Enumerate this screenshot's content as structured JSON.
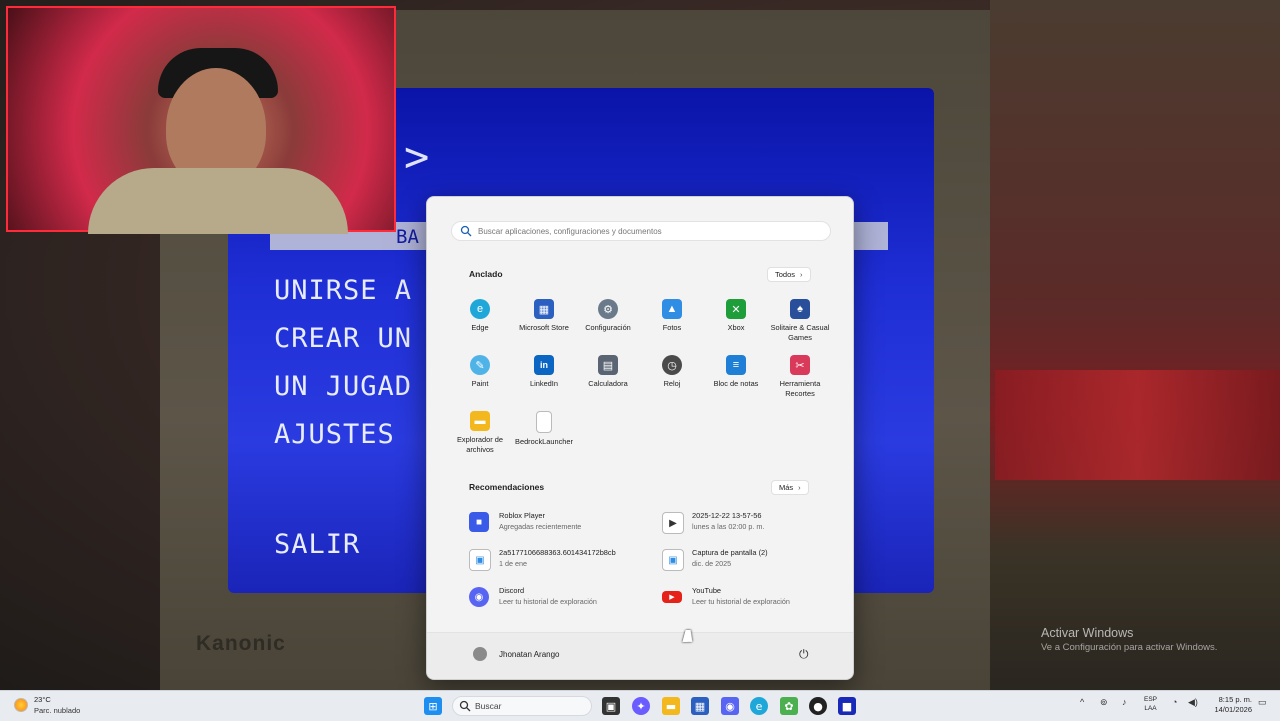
{
  "game": {
    "arrow": ">",
    "selected_label": "BA",
    "menu": [
      "UNIRSE A",
      "CREAR UN",
      "UN JUGAD",
      "AJUSTES",
      "SALIR"
    ],
    "brand": "Kanonic"
  },
  "start_menu": {
    "search_placeholder": "Buscar aplicaciones, configuraciones y documentos",
    "pinned_title": "Anclado",
    "all_button": "Todos",
    "pinned": [
      {
        "label": "Edge",
        "icon": "edge-icon",
        "color": "#1fa7d9"
      },
      {
        "label": "Microsoft Store",
        "icon": "store-icon",
        "color": "#2b5fc0"
      },
      {
        "label": "Configuración",
        "icon": "gear-icon",
        "color": "#6b7a8a"
      },
      {
        "label": "Fotos",
        "icon": "photos-icon",
        "color": "#2f8de4"
      },
      {
        "label": "Xbox",
        "icon": "xbox-icon",
        "color": "#1e9e3a"
      },
      {
        "label": "Solitaire & Casual Games",
        "icon": "cards-icon",
        "color": "#2a4f9a"
      },
      {
        "label": "Paint",
        "icon": "paint-icon",
        "color": "#4fb3e8"
      },
      {
        "label": "LinkedIn",
        "icon": "linkedin-icon",
        "color": "#0a66c2"
      },
      {
        "label": "Calculadora",
        "icon": "calculator-icon",
        "color": "#5a6472"
      },
      {
        "label": "Reloj",
        "icon": "clock-icon",
        "color": "#4a4a4a"
      },
      {
        "label": "Bloc de notas",
        "icon": "notepad-icon",
        "color": "#1f7fd6"
      },
      {
        "label": "Herramienta Recortes",
        "icon": "snip-icon",
        "color": "#d93a5a"
      },
      {
        "label": "Explorador de archivos",
        "icon": "folder-icon",
        "color": "#f2b81e"
      },
      {
        "label": "BedrockLauncher",
        "icon": "file-icon",
        "color": "#ffffff"
      }
    ],
    "recs_title": "Recomendaciones",
    "more_button": "Más",
    "recommendations": [
      {
        "title": "Roblox Player",
        "sub": "Agregadas recientemente",
        "icon": "roblox-icon",
        "color": "#3a5be8"
      },
      {
        "title": "2025-12-22 13-57-56",
        "sub": "lunes a las 02:00 p. m.",
        "icon": "video-icon",
        "color": "#333333"
      },
      {
        "title": "2a5177106688363.601434172b8cb",
        "sub": "1 de ene",
        "icon": "image-file-icon",
        "color": "#2f8de4"
      },
      {
        "title": "Captura de pantalla (2)",
        "sub": "dic. de 2025",
        "icon": "image-file-icon",
        "color": "#2f8de4"
      },
      {
        "title": "Discord",
        "sub": "Leer tu historial de exploración",
        "icon": "discord-icon",
        "color": "#5865f2"
      },
      {
        "title": "YouTube",
        "sub": "Leer tu historial de exploración",
        "icon": "youtube-icon",
        "color": "#e62117"
      }
    ],
    "user_name": "Jhonatan Arango"
  },
  "watermark": {
    "line1": "Activar Windows",
    "line2": "Ve a Configuración para activar Windows."
  },
  "taskbar": {
    "temperature": "23°C",
    "weather": "Parc. nublado",
    "search_label": "Buscar",
    "lang_line1": "ESP",
    "lang_line2": "LAA",
    "time": "8:15 p. m.",
    "date": "14/01/2026"
  }
}
